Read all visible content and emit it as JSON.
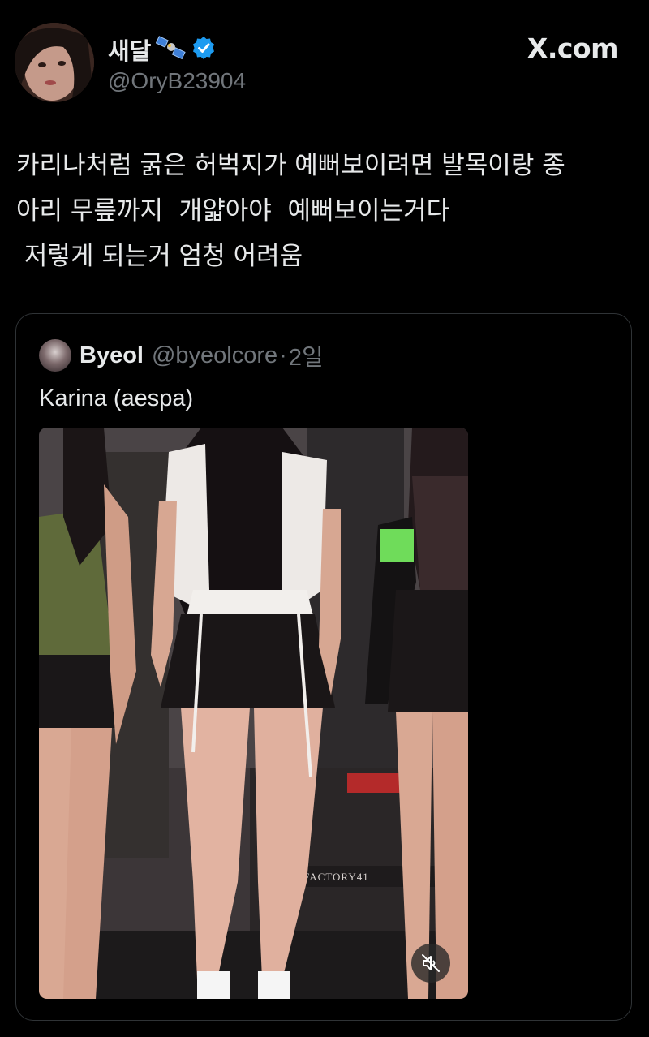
{
  "author": {
    "display_name": "새달",
    "handle": "@OryB23904",
    "verified": true,
    "name_icon": "satellite-icon"
  },
  "site_badge": "X.com",
  "tweet": {
    "text": "카리나처럼 굵은 허벅지가 예뻐보이려면 발목이랑 종\n아리 무릎까지  개얇아야  예뻐보이는거다\n 저렇게 되는거 엄청 어려움"
  },
  "quoted_tweet": {
    "name": "Byeol",
    "handle": "@byeolcore",
    "separator": "·",
    "time": "2일",
    "text": "Karina (aespa)",
    "media": {
      "type": "video",
      "backdrop_sign": "FACTORY41",
      "muted": true
    }
  },
  "colors": {
    "background": "#000000",
    "text_primary": "#e7e9ea",
    "text_secondary": "#71767b",
    "border": "#2f3336",
    "verified_blue": "#1d9bf0"
  }
}
